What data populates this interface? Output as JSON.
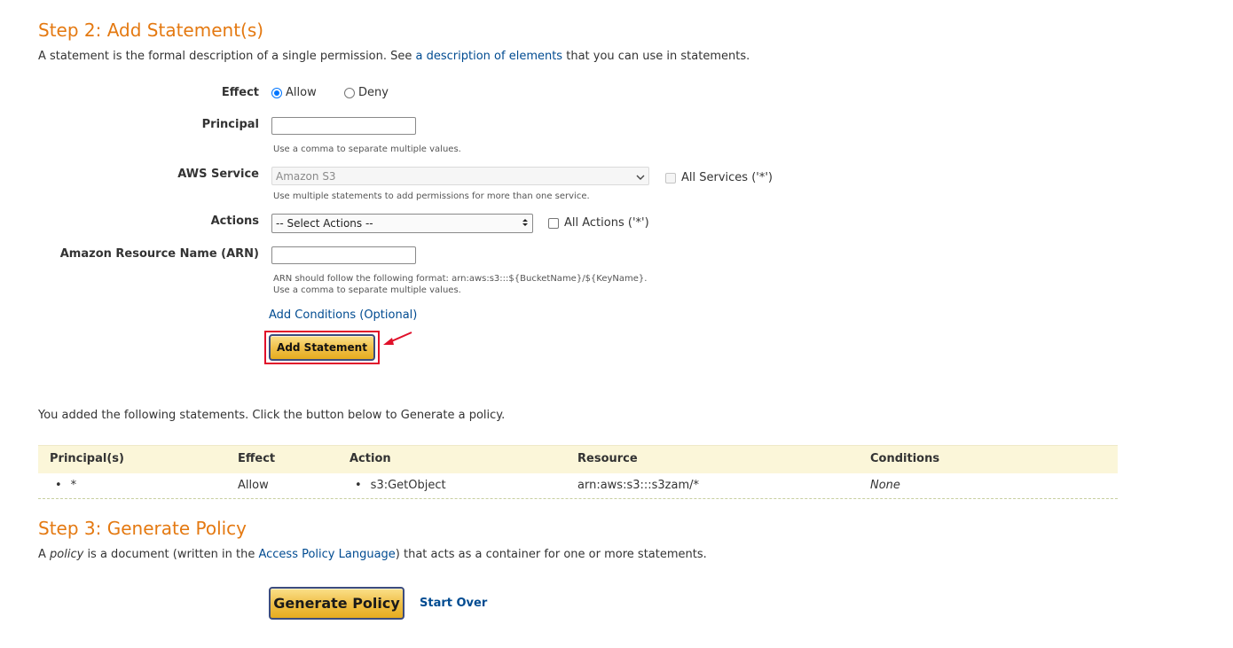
{
  "step2": {
    "title": "Step 2: Add Statement(s)",
    "desc_before": "A statement is the formal description of a single permission. See ",
    "desc_link": "a description of elements",
    "desc_after": " that you can use in statements."
  },
  "form": {
    "effect_label": "Effect",
    "effect_allow": "Allow",
    "effect_deny": "Deny",
    "principal_label": "Principal",
    "principal_value": "",
    "principal_hint": "Use a comma to separate multiple values.",
    "service_label": "AWS Service",
    "service_value": "Amazon S3",
    "service_hint": "Use multiple statements to add permissions for more than one service.",
    "all_services_label": "All Services ('*')",
    "actions_label": "Actions",
    "actions_value": "-- Select Actions --",
    "all_actions_label": "All Actions ('*')",
    "arn_label": "Amazon Resource Name (ARN)",
    "arn_value": "",
    "arn_hint_line1": "ARN should follow the following format: arn:aws:s3:::${BucketName}/${KeyName}.",
    "arn_hint_line2": "Use a comma to separate multiple values.",
    "add_conditions": "Add Conditions (Optional)",
    "add_statement": "Add Statement"
  },
  "statements": {
    "intro": "You added the following statements. Click the button below to Generate a policy.",
    "headers": [
      "Principal(s)",
      "Effect",
      "Action",
      "Resource",
      "Conditions"
    ],
    "row": {
      "principal": "*",
      "effect": "Allow",
      "action": "s3:GetObject",
      "resource": "arn:aws:s3:::s3zam/*",
      "conditions": "None"
    }
  },
  "step3": {
    "title": "Step 3: Generate Policy",
    "desc_a": "A ",
    "desc_policy": "policy",
    "desc_b": " is a document (written in the ",
    "desc_link": "Access Policy Language",
    "desc_c": ") that acts as a container for one or more statements.",
    "generate_button": "Generate Policy",
    "start_over": "Start Over"
  },
  "colors": {
    "title_orange": "#e47911",
    "link_blue": "#004b91",
    "table_header_bg": "#fbf6d9",
    "highlight_red": "#e0102a"
  }
}
